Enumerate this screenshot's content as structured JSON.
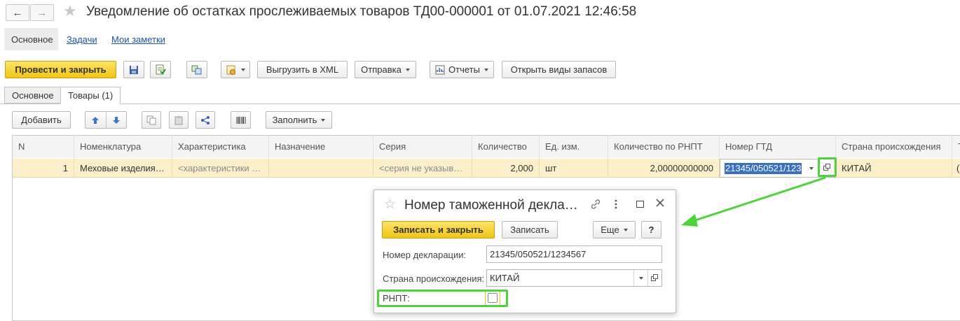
{
  "window": {
    "title": "Уведомление об остатках прослеживаемых товаров ТД00-000001 от 01.07.2021 12:46:58",
    "back_icon": "←",
    "forward_icon": "→",
    "star_icon": "★"
  },
  "sections": {
    "main": "Основное",
    "tasks": "Задачи",
    "notes": "Мои заметки"
  },
  "toolbar": {
    "post_close": "Провести и закрыть",
    "export_xml": "Выгрузить в XML",
    "send": "Отправка",
    "reports": "Отчеты",
    "open_stock_kinds": "Открыть виды запасов"
  },
  "tabs": [
    "Основное",
    "Товары (1)"
  ],
  "table_toolbar": {
    "add": "Добавить",
    "fill": "Заполнить"
  },
  "table": {
    "columns": [
      "N",
      "Номенклатура",
      "Характеристика",
      "Назначение",
      "Серия",
      "Количество",
      "Ед. изм.",
      "Количество по РНПТ",
      "Номер ГТД",
      "Страна происхождения",
      "Т"
    ],
    "rows": [
      {
        "n": "1",
        "nomenclature": "Меховые изделия…",
        "characteristic": "<характеристики …",
        "purpose": "",
        "series": "<серия не указыв…",
        "quantity": "2,000",
        "unit": "шт",
        "rnpt_quantity": "2,00000000000",
        "gtd": "21345/050521/123",
        "country": "КИТАЙ",
        "last": "("
      }
    ]
  },
  "dialog": {
    "title": "Номер таможенной декла…",
    "save_close": "Записать и закрыть",
    "save": "Записать",
    "more": "Еще",
    "help": "?",
    "declaration_label": "Номер декларации:",
    "declaration_value": "21345/050521/1234567",
    "country_label": "Страна происхождения:",
    "country_value": "КИТАЙ",
    "rnpt_label": "РНПТ:",
    "rnpt_checked": false
  },
  "colors": {
    "accent_yellow": "#f2c514",
    "highlight_green": "#4fd33a",
    "row_selected": "#fbf0c9",
    "selection_blue": "#3a6fc4"
  }
}
